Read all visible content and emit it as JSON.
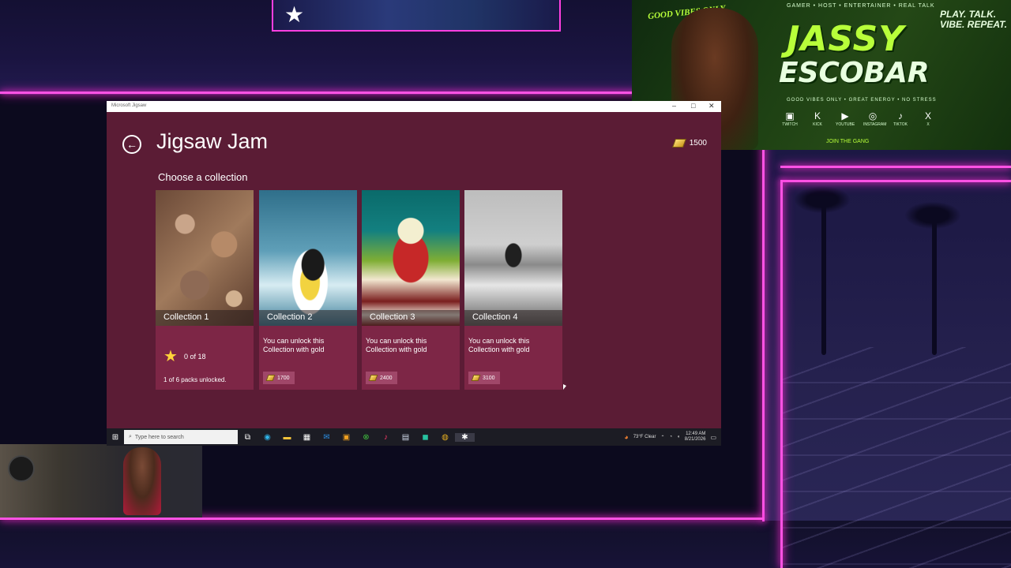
{
  "overlay": {
    "brand_tag_left": "GOOD VIBES ONLY",
    "brand_top_line": "GAMER • HOST • ENTERTAINER • REAL TALK",
    "brand_name_first": "JASSY",
    "brand_name_last": "ESCOBAR",
    "brand_slogan": "PLAY. TALK. VIBE. REPEAT.",
    "brand_band": "GOOD VIBES ONLY • GREAT ENERGY • NO STRESS",
    "join": "JOIN THE GANG",
    "socials": [
      {
        "icon": "twitch-icon",
        "glyph": "▣",
        "label": "TWITCH"
      },
      {
        "icon": "kick-icon",
        "glyph": "K",
        "label": "KICK"
      },
      {
        "icon": "youtube-icon",
        "glyph": "▶",
        "label": "YOUTUBE"
      },
      {
        "icon": "instagram-icon",
        "glyph": "◎",
        "label": "INSTAGRAM"
      },
      {
        "icon": "tiktok-icon",
        "glyph": "♪",
        "label": "TIKTOK"
      },
      {
        "icon": "x-icon",
        "glyph": "X",
        "label": "X"
      }
    ]
  },
  "window": {
    "titlebar_text": "Microsoft Jigsaw",
    "minimize": "–",
    "maximize": "□",
    "close": "✕"
  },
  "app": {
    "back_glyph": "←",
    "title": "Jigsaw Jam",
    "gold_amount": "1500",
    "subtitle": "Choose a collection",
    "collections": [
      {
        "name": "Collection 1",
        "image": "seashells",
        "progress": "0 of 18",
        "packs": "1 of 6 packs unlocked."
      },
      {
        "name": "Collection 2",
        "image": "penguin",
        "unlock_text": "You can unlock this Collection with gold",
        "price": "1700"
      },
      {
        "name": "Collection 3",
        "image": "dessert",
        "unlock_text": "You can unlock this Collection with gold",
        "price": "2400"
      },
      {
        "name": "Collection 4",
        "image": "surfer",
        "unlock_text": "You can unlock this Collection with gold",
        "price": "3100"
      }
    ]
  },
  "taskbar": {
    "search_placeholder": "Type here to search",
    "weather": "73°F  Clear",
    "time": "12:49 AM",
    "date": "8/21/2026",
    "pinned": [
      {
        "icon": "task-view-icon",
        "glyph": "⧉",
        "color": "#ffffff"
      },
      {
        "icon": "edge-icon",
        "glyph": "◉",
        "color": "#2fb3e8"
      },
      {
        "icon": "file-explorer-icon",
        "glyph": "▬",
        "color": "#f2c33a"
      },
      {
        "icon": "store-icon",
        "glyph": "▦",
        "color": "#ffffff"
      },
      {
        "icon": "mail-icon",
        "glyph": "✉",
        "color": "#2b8de0"
      },
      {
        "icon": "app-icon",
        "glyph": "▣",
        "color": "#f0a020"
      },
      {
        "icon": "xbox-icon",
        "glyph": "⊗",
        "color": "#3fbf3f"
      },
      {
        "icon": "tiktok-icon",
        "glyph": "♪",
        "color": "#ff3a6a"
      },
      {
        "icon": "photos-icon",
        "glyph": "▤",
        "color": "#cfd8e8"
      },
      {
        "icon": "app-icon-green",
        "glyph": "◼",
        "color": "#27c2a0"
      },
      {
        "icon": "chrome-icon",
        "glyph": "◍",
        "color": "#e8b020"
      },
      {
        "icon": "jigsaw-icon",
        "glyph": "✱",
        "color": "#ffffff"
      }
    ]
  },
  "colors": {
    "accent_neon": "#ff3fe0",
    "app_bg": "#5b1c35",
    "card_bg": "#7d2646",
    "gold": "#f2c33a"
  }
}
